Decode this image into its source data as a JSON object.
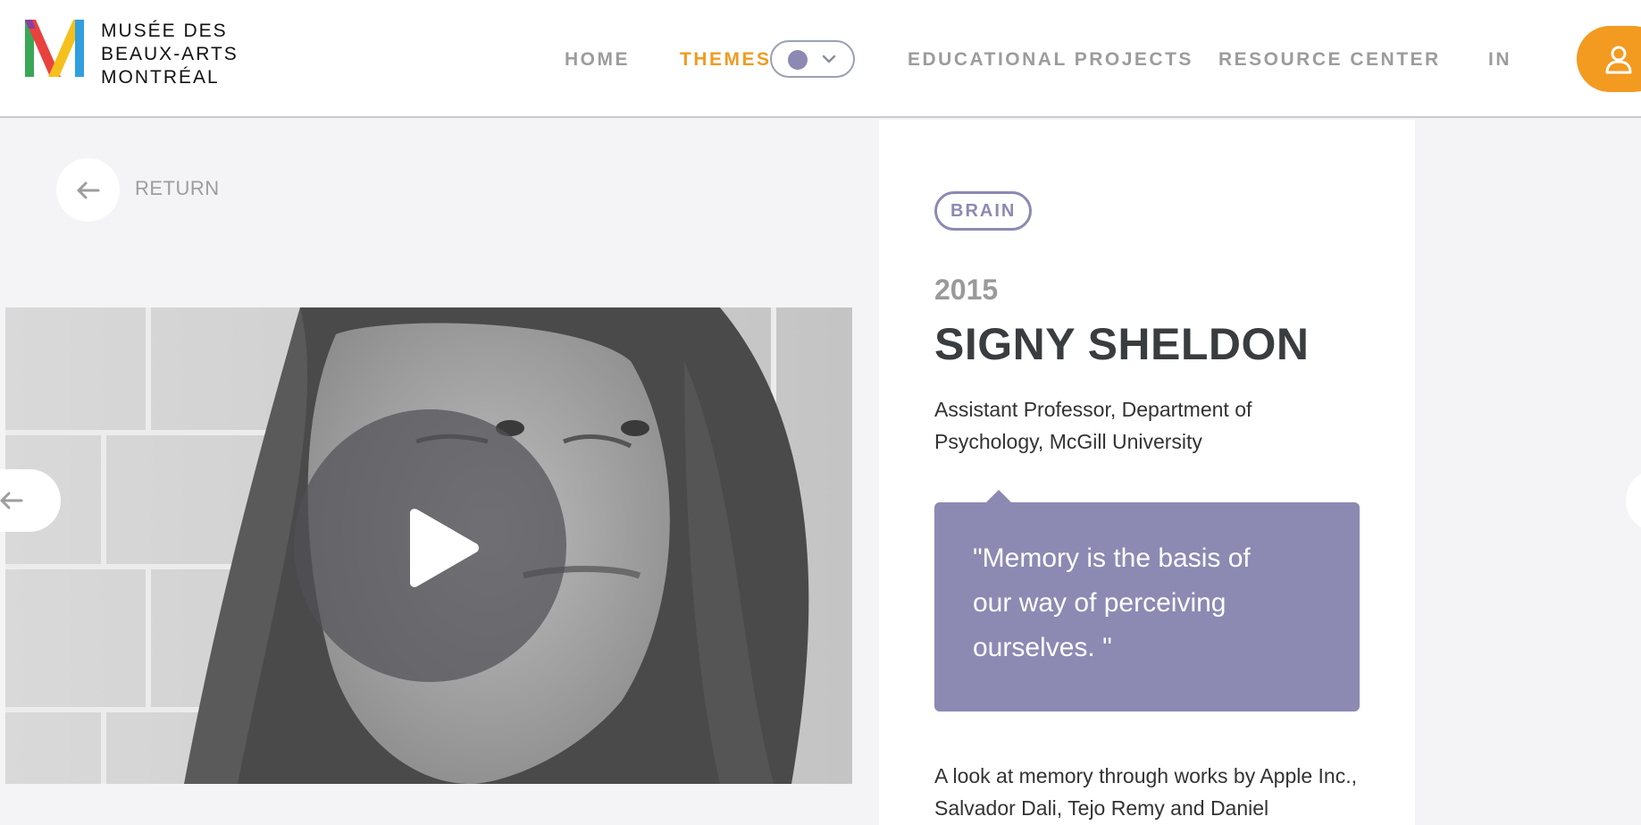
{
  "logo": {
    "lines": [
      "MUSÉE DES",
      "BEAUX-ARTS",
      "MONTRÉAL"
    ],
    "colors": [
      "#8b3fa0",
      "#e8423f",
      "#f6c01c",
      "#3aa857",
      "#2f9fe0"
    ]
  },
  "nav": {
    "home": "HOME",
    "themes": "THEMES",
    "educational_projects": "EDUCATIONAL PROJECTS",
    "resource_center": "RESOURCE CENTER",
    "language": "IN"
  },
  "theme_selector": {
    "selected_color": "#8c89b3",
    "icon": "chevron-down-icon"
  },
  "user": {
    "icon": "user-icon",
    "color": "#f39a21"
  },
  "return": {
    "label": "RETURN",
    "icon": "arrow-left-icon"
  },
  "video": {
    "play_icon": "play-icon"
  },
  "profile": {
    "tag": "BRAIN",
    "year": "2015",
    "name": "SIGNY SHELDON",
    "role": "Assistant Professor, Department of Psychology, McGill University",
    "quote": "\"Memory is the basis of our way of perceiving ourselves. \"",
    "description": "A look at memory through works by Apple Inc., Salvador Dali, Tejo Remy and Daniel"
  },
  "colors": {
    "accent": "#f19b22",
    "theme_purple": "#8c89b3",
    "nav_gray": "#9c9c9c",
    "heading": "#3a3d40"
  }
}
